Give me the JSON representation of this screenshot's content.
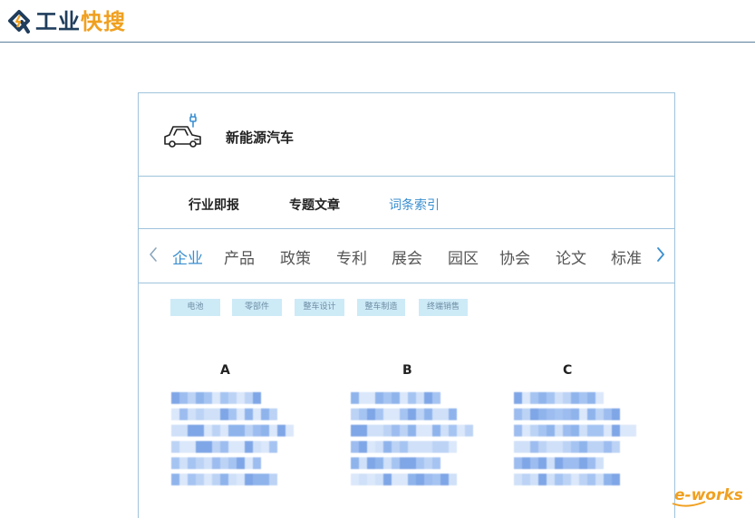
{
  "header": {
    "logo_text_a": "工业",
    "logo_text_b": "快搜",
    "logo_icon": "q-lightning-logo"
  },
  "topic": {
    "title": "新能源汽车",
    "icon": "electric-car-icon"
  },
  "tabs": [
    {
      "label": "行业即报",
      "active": false
    },
    {
      "label": "专题文章",
      "active": false
    },
    {
      "label": "词条索引",
      "active": true
    }
  ],
  "categories": [
    {
      "label": "企业",
      "active": true
    },
    {
      "label": "产品",
      "active": false
    },
    {
      "label": "政策",
      "active": false
    },
    {
      "label": "专利",
      "active": false
    },
    {
      "label": "展会",
      "active": false
    },
    {
      "label": "园区",
      "active": false
    },
    {
      "label": "协会",
      "active": false
    },
    {
      "label": "论文",
      "active": false
    },
    {
      "label": "标准",
      "active": false
    }
  ],
  "chips": [
    "电池",
    "零部件",
    "整车设计",
    "整车制造",
    "终端销售"
  ],
  "index_letters": [
    "A",
    "B",
    "C"
  ],
  "watermark": "e-works",
  "colors": {
    "accent": "#3a8fd0",
    "border": "#9fc3dc",
    "chip_bg": "#cdeaf7",
    "logo_dark": "#1f3d5c",
    "logo_orange": "#f0a020"
  }
}
